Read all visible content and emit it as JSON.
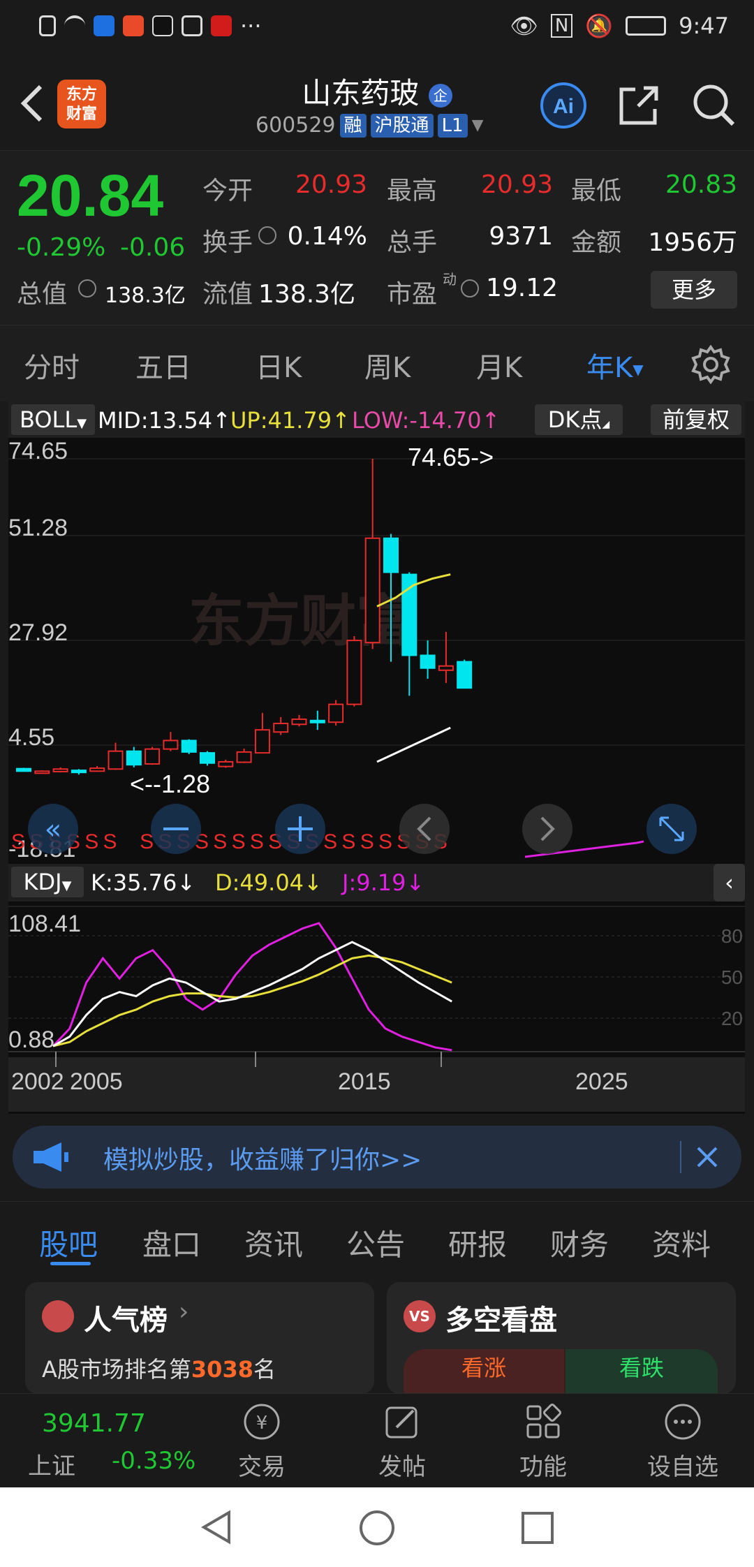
{
  "status_bar": {
    "time": "9:47",
    "dots": "···"
  },
  "header": {
    "logo_line1": "东方",
    "logo_line2": "财富",
    "title": "山东药玻",
    "title_badge": "企",
    "code": "600529",
    "tags": [
      "融",
      "沪股通",
      "L1"
    ]
  },
  "quote": {
    "price": "20.84",
    "change_pct": "-0.29%",
    "change_amt": "-0.06",
    "rows": [
      [
        {
          "label": "今开",
          "value": "20.93",
          "color": "red"
        },
        {
          "label": "最高",
          "value": "20.93",
          "color": "red"
        },
        {
          "label": "最低",
          "value": "20.83",
          "color": "green"
        }
      ],
      [
        {
          "label": "换手",
          "value": "0.14%",
          "color": "white"
        },
        {
          "label": "总手",
          "value": "9371",
          "color": "white"
        },
        {
          "label": "金额",
          "value": "1956万",
          "color": "white"
        }
      ]
    ],
    "total_value_label": "总值",
    "total_value": "138.3亿",
    "float_value_label": "流值",
    "float_value": "138.3亿",
    "pe_label": "市盈",
    "pe_sup": "动",
    "pe_value": "19.12",
    "more_label": "更多"
  },
  "tabs": [
    "分时",
    "五日",
    "日K",
    "周K",
    "月K",
    "年K"
  ],
  "active_tab": "年K",
  "indicator": {
    "name": "BOLL",
    "mid": "MID:13.54↑",
    "up": "UP:41.79↑",
    "low": "LOW:-14.70↑",
    "dk": "DK点",
    "adjust": "前复权"
  },
  "kline": {
    "y_labels": [
      "74.65",
      "51.28",
      "27.92",
      "4.55",
      "-18.81"
    ],
    "max_label": "74.65->",
    "min_label": "<--1.28",
    "s_marker": "S"
  },
  "kdj": {
    "name": "KDJ",
    "k": "K:35.76↓",
    "d": "D:49.04↓",
    "j": "J:9.19↓",
    "y_top": "108.41",
    "y_bottom": "0.88",
    "levels": [
      "80",
      "50",
      "20"
    ]
  },
  "x_labels": [
    "2002",
    "2005",
    "2015",
    "2025"
  ],
  "banner": {
    "text": "模拟炒股，收益赚了归你>>"
  },
  "bottom_tabs": [
    "股吧",
    "盘口",
    "资讯",
    "公告",
    "研报",
    "财务",
    "资料"
  ],
  "active_bottom_tab": "股吧",
  "cards": {
    "popular_title": "人气榜",
    "popular_text_prefix": "A股市场排名第",
    "popular_rank": "3038",
    "popular_text_suffix": "名",
    "vs_title": "多空看盘",
    "vs_badge": "VS",
    "bull": "看涨",
    "bear": "看跌"
  },
  "nav": {
    "index_value": "3941.77",
    "index_name": "上证",
    "index_change": "-0.33%",
    "items": [
      "交易",
      "发帖",
      "功能",
      "设自选"
    ]
  },
  "colors": {
    "up": "#e82b2b",
    "down": "#1fc832",
    "accent": "#3a8bf0",
    "candle_down": "#00e5ee",
    "up_band": "#e8e03a",
    "kdj_j": "#e020e0"
  },
  "candles": [
    {
      "year": 2002,
      "o": 1.9,
      "c": 1.3,
      "h": 2.1,
      "l": 1.28
    },
    {
      "year": 2003,
      "o": 1.1,
      "c": 1.3,
      "h": 1.5,
      "l": 0.9
    },
    {
      "year": 2004,
      "o": 1.2,
      "c": 1.8,
      "h": 2.2,
      "l": 1.0
    },
    {
      "year": 2005,
      "o": 1.5,
      "c": 1.0,
      "h": 1.8,
      "l": 0.5
    },
    {
      "year": 2006,
      "o": 1.3,
      "c": 2.0,
      "h": 2.5,
      "l": 1.2
    },
    {
      "year": 2007,
      "o": 1.8,
      "c": 6.0,
      "h": 8.0,
      "l": 1.6
    },
    {
      "year": 2008,
      "o": 6.0,
      "c": 2.8,
      "h": 7.0,
      "l": 2.2
    },
    {
      "year": 2009,
      "o": 3.0,
      "c": 6.5,
      "h": 7.0,
      "l": 2.8
    },
    {
      "year": 2010,
      "o": 6.5,
      "c": 8.5,
      "h": 10.5,
      "l": 6.0
    },
    {
      "year": 2011,
      "o": 8.5,
      "c": 5.8,
      "h": 8.8,
      "l": 5.3
    },
    {
      "year": 2012,
      "o": 5.6,
      "c": 3.2,
      "h": 6.0,
      "l": 2.6
    },
    {
      "year": 2013,
      "o": 2.4,
      "c": 3.5,
      "h": 4.0,
      "l": 2.1
    },
    {
      "year": 2014,
      "o": 3.4,
      "c": 5.8,
      "h": 6.6,
      "l": 3.2
    },
    {
      "year": 2015,
      "o": 5.6,
      "c": 11.0,
      "h": 15.0,
      "l": 5.5
    },
    {
      "year": 2016,
      "o": 10.5,
      "c": 12.5,
      "h": 14.0,
      "l": 9.8
    },
    {
      "year": 2017,
      "o": 12.3,
      "c": 13.5,
      "h": 14.5,
      "l": 11.8
    },
    {
      "year": 2018,
      "o": 13.2,
      "c": 12.8,
      "h": 15.5,
      "l": 11.0
    },
    {
      "year": 2019,
      "o": 12.8,
      "c": 17.0,
      "h": 18.0,
      "l": 12.0
    },
    {
      "year": 2020,
      "o": 17.0,
      "c": 32.0,
      "h": 33.0,
      "l": 16.5
    },
    {
      "year": 2021,
      "o": 31.5,
      "c": 56.0,
      "h": 74.65,
      "l": 30.0
    },
    {
      "year": 2022,
      "o": 56.0,
      "c": 48.0,
      "h": 57.0,
      "l": 27.0
    },
    {
      "year": 2023,
      "o": 47.5,
      "c": 28.5,
      "h": 48.0,
      "l": 19.0
    },
    {
      "year": 2024,
      "o": 28.5,
      "c": 25.5,
      "h": 32.0,
      "l": 23.0
    },
    {
      "year": 2025,
      "o": 25.0,
      "c": 26.0,
      "h": 34.0,
      "l": 22.0
    },
    {
      "year": 2026,
      "o": 27.0,
      "c": 20.84,
      "h": 27.5,
      "l": 20.83
    }
  ],
  "chart_data": {
    "type": "candlestick",
    "y_range": [
      -18.81,
      74.65
    ],
    "boll_up": [
      [
        2022,
        40.0
      ],
      [
        2023,
        42.0
      ],
      [
        2024,
        45.0
      ],
      [
        2025,
        46.5
      ],
      [
        2026,
        47.5
      ]
    ],
    "boll_low": [
      [
        2022,
        3.5
      ],
      [
        2023,
        5.5
      ],
      [
        2024,
        7.5
      ],
      [
        2025,
        9.5
      ],
      [
        2026,
        11.5
      ]
    ],
    "kdj_range": [
      0.88,
      108.41
    ],
    "kdj_k": [
      [
        2003,
        5
      ],
      [
        2004,
        12
      ],
      [
        2005,
        28
      ],
      [
        2006,
        40
      ],
      [
        2007,
        45
      ],
      [
        2008,
        42
      ],
      [
        2009,
        50
      ],
      [
        2010,
        55
      ],
      [
        2011,
        52
      ],
      [
        2012,
        45
      ],
      [
        2013,
        38
      ],
      [
        2014,
        40
      ],
      [
        2015,
        45
      ],
      [
        2016,
        50
      ],
      [
        2017,
        56
      ],
      [
        2018,
        62
      ],
      [
        2019,
        70
      ],
      [
        2020,
        76
      ],
      [
        2021,
        82
      ],
      [
        2022,
        76
      ],
      [
        2023,
        68
      ],
      [
        2024,
        60
      ],
      [
        2025,
        52
      ],
      [
        2026,
        45
      ],
      [
        2027,
        38
      ]
    ],
    "kdj_d": [
      [
        2003,
        5
      ],
      [
        2004,
        8
      ],
      [
        2005,
        16
      ],
      [
        2006,
        22
      ],
      [
        2007,
        28
      ],
      [
        2008,
        32
      ],
      [
        2009,
        38
      ],
      [
        2010,
        42
      ],
      [
        2011,
        44
      ],
      [
        2012,
        44
      ],
      [
        2013,
        42
      ],
      [
        2014,
        41
      ],
      [
        2015,
        42
      ],
      [
        2016,
        45
      ],
      [
        2017,
        49
      ],
      [
        2018,
        53
      ],
      [
        2019,
        58
      ],
      [
        2020,
        64
      ],
      [
        2021,
        70
      ],
      [
        2022,
        72
      ],
      [
        2023,
        70
      ],
      [
        2024,
        67
      ],
      [
        2025,
        62
      ],
      [
        2026,
        57
      ],
      [
        2027,
        52
      ]
    ],
    "kdj_j": [
      [
        2003,
        5
      ],
      [
        2004,
        18
      ],
      [
        2005,
        52
      ],
      [
        2006,
        70
      ],
      [
        2007,
        55
      ],
      [
        2008,
        70
      ],
      [
        2009,
        76
      ],
      [
        2010,
        62
      ],
      [
        2011,
        40
      ],
      [
        2012,
        32
      ],
      [
        2013,
        40
      ],
      [
        2014,
        58
      ],
      [
        2015,
        72
      ],
      [
        2016,
        80
      ],
      [
        2017,
        86
      ],
      [
        2018,
        92
      ],
      [
        2019,
        96
      ],
      [
        2020,
        78
      ],
      [
        2021,
        55
      ],
      [
        2022,
        32
      ],
      [
        2023,
        18
      ],
      [
        2024,
        12
      ],
      [
        2025,
        8
      ],
      [
        2026,
        4
      ],
      [
        2027,
        2
      ]
    ]
  }
}
